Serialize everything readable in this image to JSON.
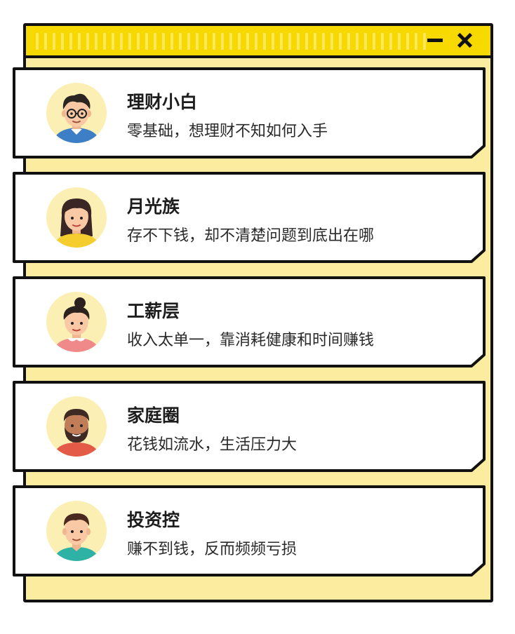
{
  "window": {
    "minimize_icon": "minimize-icon",
    "close_icon": "close-icon",
    "colors": {
      "titlebar": "#f7d900",
      "background": "#fcec9f",
      "border": "#111111"
    }
  },
  "cards": [
    {
      "title": "理财小白",
      "desc": "零基础，想理财不知如何入手",
      "avatar": "young-man-glasses-avatar"
    },
    {
      "title": "月光族",
      "desc": "存不下钱，却不清楚问题到底出在哪",
      "avatar": "woman-long-hair-avatar"
    },
    {
      "title": "工薪层",
      "desc": "收入太单一，靠消耗健康和时间赚钱",
      "avatar": "woman-bun-avatar"
    },
    {
      "title": "家庭圈",
      "desc": "花钱如流水，生活压力大",
      "avatar": "bearded-man-avatar"
    },
    {
      "title": "投资控",
      "desc": "赚不到钱，反而频频亏损",
      "avatar": "young-man-avatar"
    }
  ]
}
